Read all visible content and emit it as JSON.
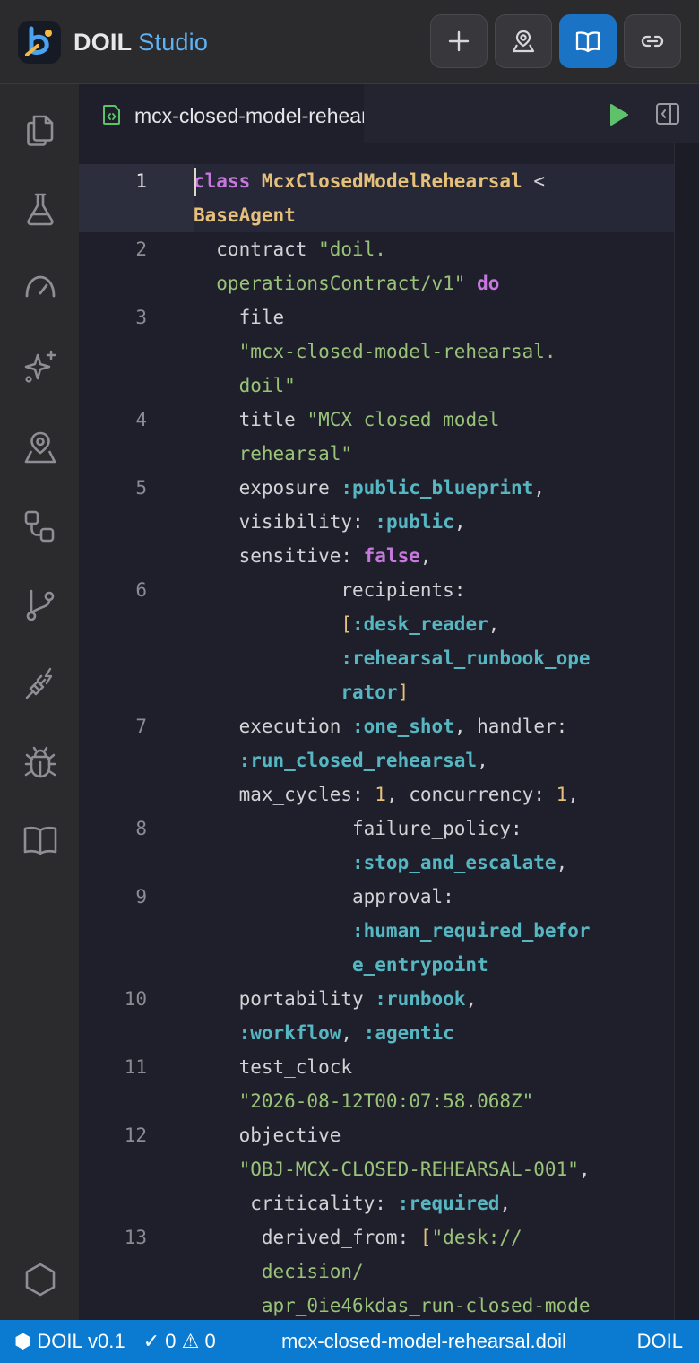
{
  "header": {
    "brand": "DOIL",
    "product": "Studio",
    "buttons": [
      {
        "name": "new",
        "icon": "plus-icon"
      },
      {
        "name": "map",
        "icon": "map-pin-icon"
      },
      {
        "name": "docs",
        "icon": "book-open-icon",
        "active": true
      },
      {
        "name": "link",
        "icon": "link-icon"
      }
    ]
  },
  "activity_bar": {
    "items": [
      "files-icon",
      "flask-icon",
      "gauge-icon",
      "sparkles-icon",
      "map-pin-icon",
      "workflow-icon",
      "git-branch-icon",
      "plug-icon",
      "bug-icon",
      "book-icon",
      "hexagon-icon"
    ]
  },
  "tab": {
    "label": "mcx-closed-model-rehearsal.doil",
    "icon": "file-code-icon"
  },
  "editor": {
    "current_line": 1,
    "lines": [
      {
        "n": "1",
        "rows": [
          [
            [
              "kw",
              "class"
            ],
            [
              "pl",
              " "
            ],
            [
              "cls",
              "McxClosedModelRehearsal"
            ],
            [
              "pl",
              " <"
            ]
          ],
          [
            [
              "cls",
              "BaseAgent"
            ]
          ]
        ]
      },
      {
        "n": "2",
        "rows": [
          [
            [
              "pl",
              "  contract "
            ],
            [
              "str",
              "\"doil."
            ]
          ],
          [
            [
              "str",
              "  operationsContract/v1\""
            ],
            [
              "pl",
              " "
            ],
            [
              "kw",
              "do"
            ]
          ]
        ]
      },
      {
        "n": "3",
        "rows": [
          [
            [
              "pl",
              "    file"
            ]
          ],
          [
            [
              "str",
              "    \"mcx-closed-model-rehearsal."
            ]
          ],
          [
            [
              "str",
              "    doil\""
            ]
          ]
        ]
      },
      {
        "n": "4",
        "rows": [
          [
            [
              "pl",
              "    title "
            ],
            [
              "str",
              "\"MCX closed model"
            ]
          ],
          [
            [
              "str",
              "    rehearsal\""
            ]
          ]
        ]
      },
      {
        "n": "5",
        "rows": [
          [
            [
              "pl",
              "    exposure "
            ],
            [
              "sym",
              ":public_blueprint"
            ],
            [
              "pl",
              ","
            ]
          ],
          [
            [
              "pl",
              "    visibility: "
            ],
            [
              "sym",
              ":public"
            ],
            [
              "pl",
              ","
            ]
          ],
          [
            [
              "pl",
              "    sensitive: "
            ],
            [
              "kw",
              "false"
            ],
            [
              "pl",
              ","
            ]
          ]
        ]
      },
      {
        "n": "6",
        "rows": [
          [
            [
              "pl",
              "             recipients:"
            ]
          ],
          [
            [
              "brk",
              "             ["
            ],
            [
              "sym",
              ":desk_reader"
            ],
            [
              "pl",
              ","
            ]
          ],
          [
            [
              "sym",
              "             :rehearsal_runbook_ope"
            ]
          ],
          [
            [
              "sym",
              "             rator"
            ],
            [
              "brk",
              "]"
            ]
          ]
        ]
      },
      {
        "n": "7",
        "rows": [
          [
            [
              "pl",
              "    execution "
            ],
            [
              "sym",
              ":one_shot"
            ],
            [
              "pl",
              ", handler:"
            ]
          ],
          [
            [
              "sym",
              "    :run_closed_rehearsal"
            ],
            [
              "pl",
              ","
            ]
          ],
          [
            [
              "pl",
              "    max_cycles: "
            ],
            [
              "num",
              "1"
            ],
            [
              "pl",
              ", concurrency: "
            ],
            [
              "num",
              "1"
            ],
            [
              "pl",
              ","
            ]
          ]
        ]
      },
      {
        "n": "8",
        "rows": [
          [
            [
              "pl",
              "              failure_policy:"
            ]
          ],
          [
            [
              "sym",
              "              :stop_and_escalate"
            ],
            [
              "pl",
              ","
            ]
          ]
        ]
      },
      {
        "n": "9",
        "rows": [
          [
            [
              "pl",
              "              approval:"
            ]
          ],
          [
            [
              "sym",
              "              :human_required_befor"
            ]
          ],
          [
            [
              "sym",
              "              e_entrypoint"
            ]
          ]
        ]
      },
      {
        "n": "10",
        "rows": [
          [
            [
              "pl",
              "    portability "
            ],
            [
              "sym",
              ":runbook"
            ],
            [
              "pl",
              ","
            ]
          ],
          [
            [
              "sym",
              "    :workflow"
            ],
            [
              "pl",
              ", "
            ],
            [
              "sym",
              ":agentic"
            ]
          ]
        ]
      },
      {
        "n": "11",
        "rows": [
          [
            [
              "pl",
              "    test_clock"
            ]
          ],
          [
            [
              "str",
              "    \"2026-08-12T00:07:58.068Z\""
            ]
          ]
        ]
      },
      {
        "n": "12",
        "rows": [
          [
            [
              "pl",
              "    objective"
            ]
          ],
          [
            [
              "str",
              "    \"OBJ-MCX-CLOSED-REHEARSAL-001\""
            ],
            [
              "pl",
              ","
            ]
          ],
          [
            [
              "pl",
              "     criticality: "
            ],
            [
              "sym",
              ":required"
            ],
            [
              "pl",
              ","
            ]
          ]
        ]
      },
      {
        "n": "13",
        "rows": [
          [
            [
              "pl",
              "      derived_from: "
            ],
            [
              "brk",
              "["
            ],
            [
              "str",
              "\"desk://"
            ]
          ],
          [
            [
              "str",
              "      decision/"
            ]
          ],
          [
            [
              "str",
              "      apr_0ie46kdas_run-closed-mode"
            ]
          ]
        ]
      }
    ]
  },
  "status_bar": {
    "version": "DOIL v0.1",
    "errors": "0",
    "warnings": "0",
    "file": "mcx-closed-model-rehearsal.doil",
    "language": "DOIL"
  },
  "colors": {
    "accent": "#1a73c4",
    "status_bar": "#0b7ad1",
    "keyword": "#c678dd",
    "class": "#e5c07b",
    "string": "#98c379",
    "symbol": "#56b6c2",
    "run": "#5ec26a"
  }
}
